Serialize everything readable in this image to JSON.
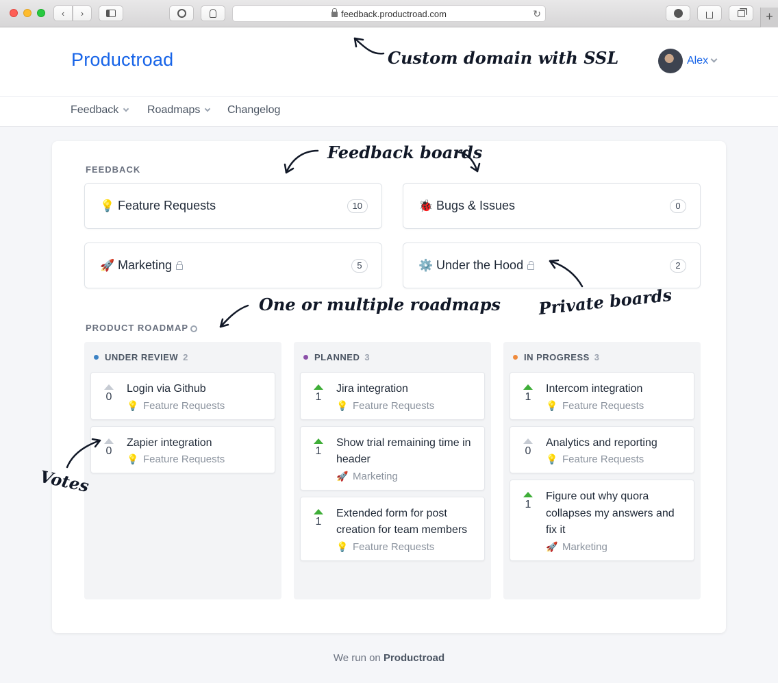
{
  "browser": {
    "url": "feedback.productroad.com"
  },
  "header": {
    "brand": "Productroad",
    "user_name": "Alex"
  },
  "nav": {
    "items": [
      {
        "label": "Feedback"
      },
      {
        "label": "Roadmaps"
      },
      {
        "label": "Changelog"
      }
    ]
  },
  "feedback": {
    "label": "FEEDBACK",
    "boards": [
      {
        "icon": "💡",
        "name": "Feature Requests",
        "count": "10",
        "private": false
      },
      {
        "icon": "🐞",
        "name": "Bugs & Issues",
        "count": "0",
        "private": false
      },
      {
        "icon": "🚀",
        "name": "Marketing",
        "count": "5",
        "private": true
      },
      {
        "icon": "⚙️",
        "name": "Under the Hood",
        "count": "2",
        "private": true
      }
    ]
  },
  "roadmap": {
    "label": "PRODUCT ROADMAP",
    "columns": [
      {
        "name": "UNDER REVIEW",
        "count": "2",
        "color": "#3b82c4",
        "posts": [
          {
            "title": "Login via Github",
            "votes": "0",
            "voted": false,
            "board": "Feature Requests",
            "board_icon": "💡"
          },
          {
            "title": "Zapier integration",
            "votes": "0",
            "voted": false,
            "board": "Feature Requests",
            "board_icon": "💡"
          }
        ]
      },
      {
        "name": "PLANNED",
        "count": "3",
        "color": "#8b4fa8",
        "posts": [
          {
            "title": "Jira integration",
            "votes": "1",
            "voted": true,
            "board": "Feature Requests",
            "board_icon": "💡"
          },
          {
            "title": "Show trial remaining time in header",
            "votes": "1",
            "voted": true,
            "board": "Marketing",
            "board_icon": "🚀"
          },
          {
            "title": "Extended form for post creation for team members",
            "votes": "1",
            "voted": true,
            "board": "Feature Requests",
            "board_icon": "💡"
          }
        ]
      },
      {
        "name": "IN PROGRESS",
        "count": "3",
        "color": "#ef8a3c",
        "posts": [
          {
            "title": "Intercom integration",
            "votes": "1",
            "voted": true,
            "board": "Feature Requests",
            "board_icon": "💡"
          },
          {
            "title": "Analytics and reporting",
            "votes": "0",
            "voted": false,
            "board": "Feature Requests",
            "board_icon": "💡"
          },
          {
            "title": "Figure out why quora collapses my answers and fix it",
            "votes": "1",
            "voted": true,
            "board": "Marketing",
            "board_icon": "🚀"
          }
        ]
      }
    ]
  },
  "annotations": {
    "custom_domain": "Custom domain with SSL",
    "feedback_boards": "Feedback boards",
    "private_boards": "Private boards",
    "roadmaps": "One or multiple roadmaps",
    "votes": "Votes"
  },
  "footer": {
    "prefix": "We run on",
    "brand": "Productroad"
  }
}
